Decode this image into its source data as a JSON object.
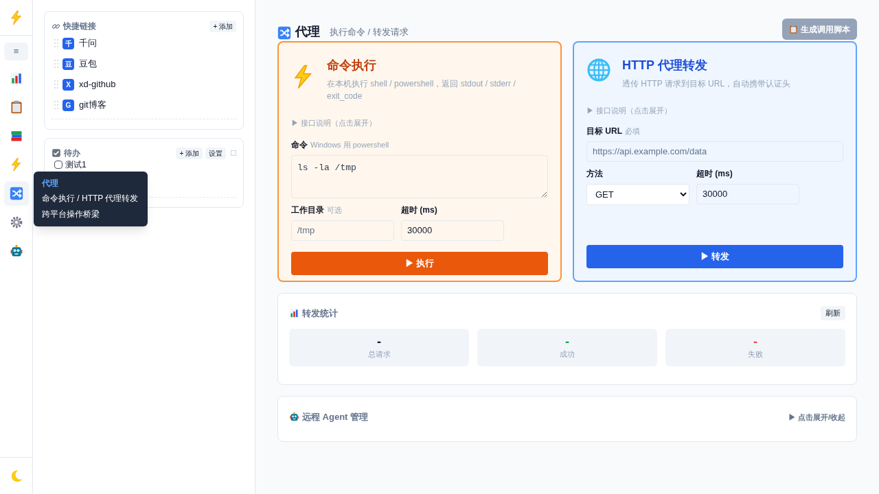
{
  "rail": {
    "items": [
      {
        "kind": "chart",
        "selected": false
      },
      {
        "kind": "clipboard",
        "selected": false
      },
      {
        "kind": "books",
        "selected": false
      },
      {
        "kind": "bolt",
        "selected": false
      },
      {
        "kind": "shuffle",
        "selected": true
      },
      {
        "kind": "gear",
        "selected": false
      },
      {
        "kind": "robot",
        "selected": false
      }
    ],
    "menu_button": "≡"
  },
  "tooltip": {
    "title": "代理",
    "lines": [
      "命令执行 / HTTP 代理转发",
      "跨平台操作桥梁"
    ]
  },
  "quick_links": {
    "title": "快捷链接",
    "add_button": "+ 添加",
    "items": [
      {
        "badge": "千",
        "label": "千问"
      },
      {
        "badge": "豆",
        "label": "豆包"
      },
      {
        "badge": "X",
        "label": "xd-github"
      },
      {
        "badge": "G",
        "label": "git博客"
      }
    ]
  },
  "todo": {
    "title": "待办",
    "add_button": "+ 添加",
    "settings_button": "设置",
    "select_all_checked": false,
    "items": [
      {
        "label": "测试1",
        "checked": false
      }
    ]
  },
  "header": {
    "title": "代理",
    "subtitle": "执行命令 / 转发请求",
    "script_button": "生成调用脚本"
  },
  "exec_card": {
    "title": "命令执行",
    "description": "在本机执行 shell / powershell，返回 stdout / stderr / exit_code",
    "api_toggle": "▶ 接口说明（点击展开）",
    "command_label": "命令",
    "command_hint": "Windows 用 powershell",
    "command_value": "ls -la /tmp",
    "workdir_label": "工作目录",
    "workdir_hint": "可选",
    "workdir_placeholder": "/tmp",
    "timeout_label": "超时 (ms)",
    "timeout_value": "30000",
    "run_button": "▶ 执行"
  },
  "http_card": {
    "title": "HTTP 代理转发",
    "description": "透传 HTTP 请求到目标 URL，自动携带认证头",
    "api_toggle": "▶ 接口说明（点击展开）",
    "url_label": "目标 URL",
    "url_hint": "必填",
    "url_placeholder": "https://api.example.com/data",
    "method_label": "方法",
    "method_value": "GET",
    "timeout_label": "超时 (ms)",
    "timeout_value": "30000",
    "forward_button": "▶ 转发"
  },
  "stats": {
    "title": "转发统计",
    "refresh_button": "刷新",
    "items": [
      {
        "value": "-",
        "label": "总请求",
        "color": "#0f172a"
      },
      {
        "value": "-",
        "label": "成功",
        "color": "#16a34a"
      },
      {
        "value": "-",
        "label": "失败",
        "color": "#ef4444"
      }
    ]
  },
  "agent": {
    "title": "远程 Agent 管理",
    "toggle": "▶ 点击展开/收起"
  }
}
